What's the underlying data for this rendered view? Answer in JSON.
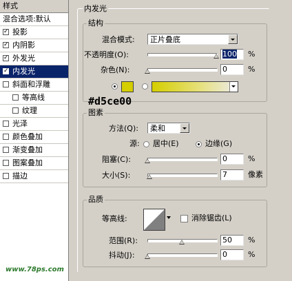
{
  "colors": {
    "accent": "#d5ce00",
    "selection": "#0a246a",
    "panel": "#d4d0c8"
  },
  "sidebar": {
    "title": "样式",
    "items": [
      {
        "label": "混合选项:默认",
        "checkbox": false,
        "checked": false,
        "selected": false,
        "indent": false
      },
      {
        "label": "投影",
        "checkbox": true,
        "checked": true,
        "selected": false,
        "indent": false
      },
      {
        "label": "内阴影",
        "checkbox": true,
        "checked": true,
        "selected": false,
        "indent": false
      },
      {
        "label": "外发光",
        "checkbox": true,
        "checked": true,
        "selected": false,
        "indent": false
      },
      {
        "label": "内发光",
        "checkbox": true,
        "checked": true,
        "selected": true,
        "indent": false
      },
      {
        "label": "斜面和浮雕",
        "checkbox": true,
        "checked": false,
        "selected": false,
        "indent": false
      },
      {
        "label": "等高线",
        "checkbox": true,
        "checked": false,
        "selected": false,
        "indent": true
      },
      {
        "label": "纹理",
        "checkbox": true,
        "checked": false,
        "selected": false,
        "indent": true
      },
      {
        "label": "光泽",
        "checkbox": true,
        "checked": false,
        "selected": false,
        "indent": false
      },
      {
        "label": "颜色叠加",
        "checkbox": true,
        "checked": false,
        "selected": false,
        "indent": false
      },
      {
        "label": "渐变叠加",
        "checkbox": true,
        "checked": false,
        "selected": false,
        "indent": false
      },
      {
        "label": "图案叠加",
        "checkbox": true,
        "checked": false,
        "selected": false,
        "indent": false
      },
      {
        "label": "描边",
        "checkbox": true,
        "checked": false,
        "selected": false,
        "indent": false
      }
    ]
  },
  "panel": {
    "title": "内发光",
    "structure": {
      "legend": "结构",
      "blend_label": "混合模式:",
      "blend_value": "正片叠底",
      "opacity_label": "不透明度(O):",
      "opacity_value": "100",
      "opacity_level": 1.0,
      "noise_label": "杂色(N):",
      "noise_value": "0",
      "noise_level": 0.0,
      "percent": "%",
      "color_hex_annotation": "#d5ce00"
    },
    "elements": {
      "legend": "图素",
      "method_label": "方法(Q):",
      "method_value": "柔和",
      "source_label": "源:",
      "source_center": "居中(E)",
      "source_edge": "边缘(G)",
      "choke_label": "阻塞(C):",
      "choke_value": "0",
      "choke_level": 0.0,
      "size_label": "大小(S):",
      "size_value": "7",
      "size_level": 0.03,
      "percent": "%",
      "pixel_unit": "像素"
    },
    "quality": {
      "legend": "品质",
      "contour_label": "等高线:",
      "antialias_label": "消除锯齿(L)",
      "range_label": "范围(R):",
      "range_value": "50",
      "range_level": 0.5,
      "jitter_label": "抖动(J):",
      "jitter_value": "0",
      "jitter_level": 0.0,
      "percent": "%"
    }
  },
  "watermark": "www.78ps.com"
}
